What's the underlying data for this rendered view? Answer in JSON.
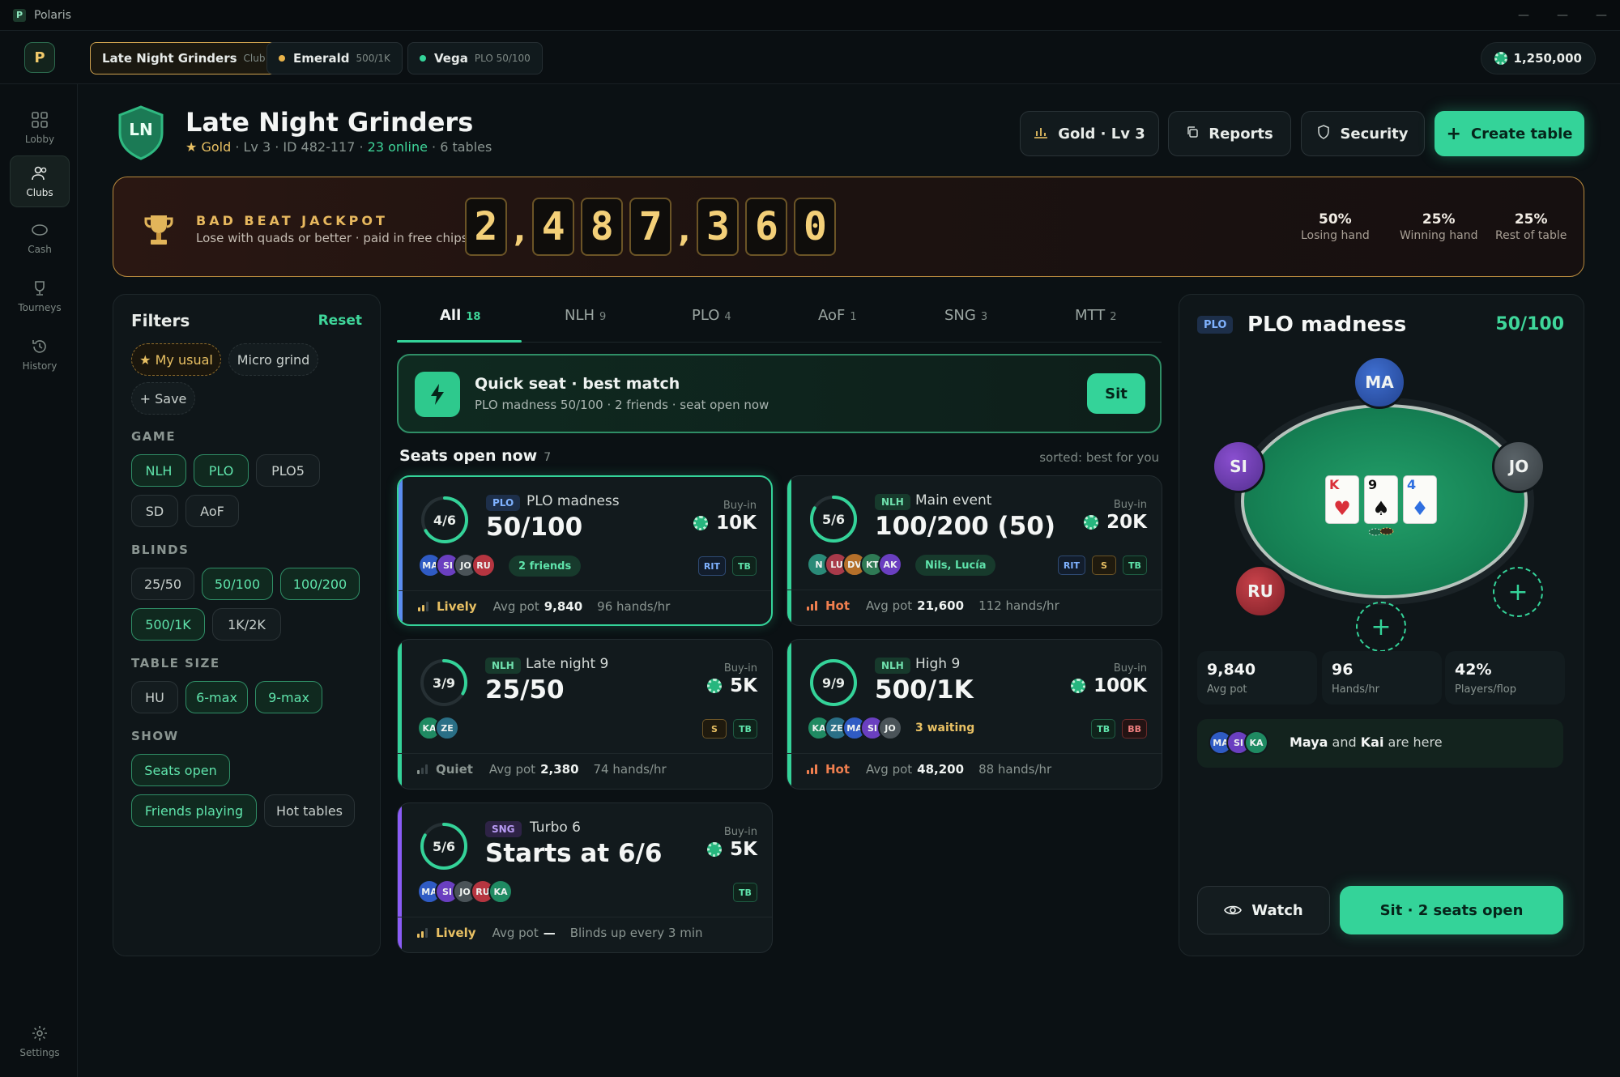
{
  "window": {
    "title": "Polaris",
    "app_icon": "P"
  },
  "topbar": {
    "logo": "P",
    "club_tabs": [
      {
        "name": "Late Night Grinders",
        "sub": "Club"
      },
      {
        "name": "Emerald",
        "sub": "500/1K",
        "dot_color": "#e8b34a"
      },
      {
        "name": "Vega",
        "sub": "PLO 50/100",
        "dot_color": "#34d399"
      }
    ],
    "balance": "1,250,000"
  },
  "sidebar": {
    "items": [
      {
        "label": "Lobby",
        "icon": "grid-icon"
      },
      {
        "label": "Clubs",
        "icon": "users-icon"
      },
      {
        "label": "Cash",
        "icon": "chip-icon"
      },
      {
        "label": "Tourneys",
        "icon": "trophy-icon"
      },
      {
        "label": "History",
        "icon": "history-icon"
      }
    ],
    "settings_label": "Settings"
  },
  "club": {
    "badge": "LN",
    "name": "Late Night Grinders",
    "tier": "Gold",
    "level": "Lv 3",
    "id": "ID 482-117",
    "online": "23 online",
    "tables": "6 tables"
  },
  "header_buttons": {
    "tier": "Gold · Lv 3",
    "reports": "Reports",
    "security": "Security",
    "create": "Create table"
  },
  "jackpot": {
    "title": "BAD BEAT JACKPOT",
    "subtitle": "Lose with quads or better · paid in free chips",
    "amount": "2,487,360",
    "digits": [
      "2",
      ",",
      "4",
      "8",
      "7",
      ",",
      "3",
      "6",
      "0"
    ],
    "splits": [
      {
        "pct": "50%",
        "label": "Losing hand"
      },
      {
        "pct": "25%",
        "label": "Winning hand"
      },
      {
        "pct": "25%",
        "label": "Rest of table"
      }
    ]
  },
  "filters": {
    "title": "Filters",
    "reset": "Reset",
    "presets": [
      "★ My usual",
      "Micro grind",
      "+ Save"
    ],
    "game_label": "GAME",
    "game": [
      "NLH",
      "PLO",
      "PLO5",
      "SD",
      "AoF"
    ],
    "blinds_label": "BLINDS",
    "blinds": [
      "25/50",
      "50/100",
      "100/200",
      "500/1K",
      "1K/2K"
    ],
    "size_label": "TABLE SIZE",
    "size": [
      "HU",
      "6-max",
      "9-max"
    ],
    "show_label": "SHOW",
    "show": [
      "Seats open",
      "Friends playing",
      "Hot tables"
    ]
  },
  "tabs": [
    {
      "label": "All",
      "count": "18"
    },
    {
      "label": "NLH",
      "count": "9"
    },
    {
      "label": "PLO",
      "count": "4"
    },
    {
      "label": "AoF",
      "count": "1"
    },
    {
      "label": "SNG",
      "count": "3"
    },
    {
      "label": "MTT",
      "count": "2"
    }
  ],
  "quickseat": {
    "title": "Quick seat · best match",
    "subtitle": "PLO madness 50/100 · 2 friends · seat open now",
    "button": "Sit"
  },
  "seats_open": {
    "title": "Seats open now",
    "count": "7",
    "sorted": "sorted: best for you"
  },
  "tables": [
    {
      "seats": "4/6",
      "fill": 0.667,
      "game": "PLO",
      "name": "PLO madness",
      "stakes": "50/100",
      "buyin_label": "Buy-in",
      "buyin": "10K",
      "avatars": [
        "MA",
        "SI",
        "JO",
        "RU"
      ],
      "friends": "2 friends",
      "tags": [
        "RIT",
        "TB"
      ],
      "activity": "Lively",
      "pot_label": "Avg pot",
      "avg_pot": "9,840",
      "rate": "96 hands/hr",
      "accent": "#5b8df0"
    },
    {
      "seats": "5/6",
      "fill": 0.833,
      "game": "NLH",
      "name": "Main event",
      "stakes": "100/200 (50)",
      "buyin_label": "Buy-in",
      "buyin": "20K",
      "avatars": [
        "N",
        "LU",
        "DV",
        "KT",
        "AK"
      ],
      "friends": "Nils, Lucía",
      "tags": [
        "RIT",
        "S",
        "TB"
      ],
      "activity": "Hot",
      "pot_label": "Avg pot",
      "avg_pot": "21,600",
      "rate": "112 hands/hr",
      "accent": "#34d399"
    },
    {
      "seats": "3/9",
      "fill": 0.333,
      "game": "NLH",
      "name": "Late night 9",
      "stakes": "25/50",
      "buyin_label": "Buy-in",
      "buyin": "5K",
      "avatars": [
        "KA",
        "ZE"
      ],
      "tags": [
        "S",
        "TB"
      ],
      "activity": "Quiet",
      "pot_label": "Avg pot",
      "avg_pot": "2,380",
      "rate": "74 hands/hr",
      "accent": "#34d399"
    },
    {
      "seats": "9/9",
      "fill": 1.0,
      "game": "NLH",
      "name": "High 9",
      "stakes": "500/1K",
      "buyin_label": "Buy-in",
      "buyin": "100K",
      "avatars": [
        "KA",
        "ZE",
        "MA",
        "SI",
        "JO"
      ],
      "waiting": "3 waiting",
      "tags": [
        "TB",
        "BB"
      ],
      "activity": "Hot",
      "pot_label": "Avg pot",
      "avg_pot": "48,200",
      "rate": "88 hands/hr",
      "accent": "#34d399"
    },
    {
      "seats": "5/6",
      "fill": 0.833,
      "game": "SNG",
      "name": "Turbo 6",
      "stakes": "Starts at 6/6",
      "buyin_label": "Buy-in",
      "buyin": "5K",
      "avatars": [
        "MA",
        "SI",
        "JO",
        "RU",
        "KA"
      ],
      "tags": [
        "TB"
      ],
      "activity": "Lively",
      "pot_label": "Avg pot",
      "avg_pot": "—",
      "rate": "Blinds up every 3 min",
      "accent": "#8b5cf6"
    }
  ],
  "detail": {
    "game": "PLO",
    "name": "PLO madness",
    "stakes": "50/100",
    "seats": [
      "MA",
      "SI",
      "JO",
      "RU"
    ],
    "board": [
      {
        "rank": "K",
        "suit": "♥",
        "color": "#d9303a"
      },
      {
        "rank": "9",
        "suit": "♠",
        "color": "#111111"
      },
      {
        "rank": "4",
        "suit": "♦",
        "color": "#2f6fe0"
      }
    ],
    "stats": [
      {
        "value": "9,840",
        "label": "Avg pot"
      },
      {
        "value": "96",
        "label": "Hands/hr"
      },
      {
        "value": "42%",
        "label": "Players/flop"
      }
    ],
    "here_avatars": [
      "MA",
      "SI",
      "KA"
    ],
    "here_name1": "Maya",
    "here_and": "and",
    "here_name2": "Kai",
    "here_suffix": "are here",
    "watch": "Watch",
    "sit": "Sit · 2 seats open"
  },
  "colors": {
    "accent": "#34d399",
    "gold": "#e8c063",
    "bg": "#0b1114"
  }
}
